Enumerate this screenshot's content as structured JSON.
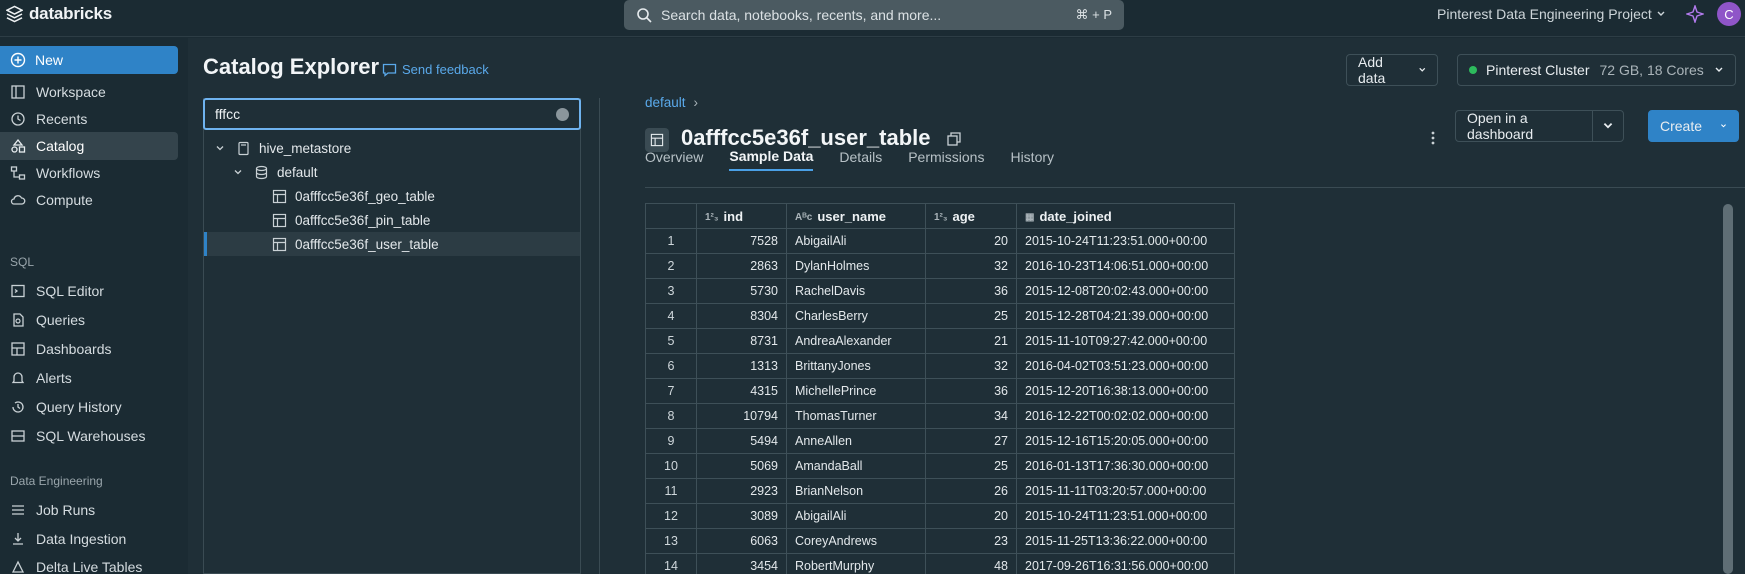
{
  "topbar": {
    "logo_text": "databricks",
    "search_placeholder": "Search data, notebooks, recents, and more...",
    "search_shortcut": "⌘ + P",
    "project": "Pinterest Data Engineering Project",
    "avatar_letter": "C"
  },
  "sidebar": {
    "new_label": "New",
    "items": [
      {
        "label": "Workspace",
        "icon": "workspace-icon"
      },
      {
        "label": "Recents",
        "icon": "clock-icon"
      },
      {
        "label": "Catalog",
        "icon": "catalog-icon"
      },
      {
        "label": "Workflows",
        "icon": "workflows-icon"
      },
      {
        "label": "Compute",
        "icon": "cloud-icon"
      }
    ],
    "sql_section": "SQL",
    "sql_items": [
      {
        "label": "SQL Editor",
        "icon": "sql-editor-icon"
      },
      {
        "label": "Queries",
        "icon": "queries-icon"
      },
      {
        "label": "Dashboards",
        "icon": "dashboard-icon"
      },
      {
        "label": "Alerts",
        "icon": "bell-icon"
      },
      {
        "label": "Query History",
        "icon": "history-icon"
      },
      {
        "label": "SQL Warehouses",
        "icon": "warehouse-icon"
      }
    ],
    "de_section": "Data Engineering",
    "de_items": [
      {
        "label": "Job Runs",
        "icon": "job-runs-icon"
      },
      {
        "label": "Data Ingestion",
        "icon": "ingestion-icon"
      },
      {
        "label": "Delta Live Tables",
        "icon": "dlt-icon"
      }
    ]
  },
  "main": {
    "title": "Catalog Explorer",
    "feedback": "Send feedback",
    "add_data": "Add data",
    "cluster_name": "Pinterest Cluster",
    "cluster_spec": "72 GB, 18 Cores",
    "filter_value": "fffcc",
    "tree": {
      "metastore": "hive_metastore",
      "schema": "default",
      "tables": [
        "0afffcc5e36f_geo_table",
        "0afffcc5e36f_pin_table",
        "0afffcc5e36f_user_table"
      ]
    },
    "breadcrumb": "default",
    "table_name": "0afffcc5e36f_user_table",
    "open_dashboard": "Open in a dashboard",
    "create": "Create",
    "tabs": [
      "Overview",
      "Sample Data",
      "Details",
      "Permissions",
      "History"
    ],
    "columns": [
      "ind",
      "user_name",
      "age",
      "date_joined"
    ],
    "rows": [
      [
        "1",
        "7528",
        "AbigailAli",
        "20",
        "2015-10-24T11:23:51.000+00:00"
      ],
      [
        "2",
        "2863",
        "DylanHolmes",
        "32",
        "2016-10-23T14:06:51.000+00:00"
      ],
      [
        "3",
        "5730",
        "RachelDavis",
        "36",
        "2015-12-08T20:02:43.000+00:00"
      ],
      [
        "4",
        "8304",
        "CharlesBerry",
        "25",
        "2015-12-28T04:21:39.000+00:00"
      ],
      [
        "5",
        "8731",
        "AndreaAlexander",
        "21",
        "2015-11-10T09:27:42.000+00:00"
      ],
      [
        "6",
        "1313",
        "BrittanyJones",
        "32",
        "2016-04-02T03:51:23.000+00:00"
      ],
      [
        "7",
        "4315",
        "MichellePrince",
        "36",
        "2015-12-20T16:38:13.000+00:00"
      ],
      [
        "8",
        "10794",
        "ThomasTurner",
        "34",
        "2016-12-22T00:02:02.000+00:00"
      ],
      [
        "9",
        "5494",
        "AnneAllen",
        "27",
        "2015-12-16T15:20:05.000+00:00"
      ],
      [
        "10",
        "5069",
        "AmandaBall",
        "25",
        "2016-01-13T17:36:30.000+00:00"
      ],
      [
        "11",
        "2923",
        "BrianNelson",
        "26",
        "2015-11-11T03:20:57.000+00:00"
      ],
      [
        "12",
        "3089",
        "AbigailAli",
        "20",
        "2015-10-24T11:23:51.000+00:00"
      ],
      [
        "13",
        "6063",
        "CoreyAndrews",
        "23",
        "2015-11-25T13:36:22.000+00:00"
      ],
      [
        "14",
        "3454",
        "RobertMurphy",
        "48",
        "2017-09-26T16:31:56.000+00:00"
      ]
    ]
  },
  "colors": {
    "accent": "#2f83c7",
    "link": "#5aa9ea",
    "status_green": "#2dbb5d"
  }
}
